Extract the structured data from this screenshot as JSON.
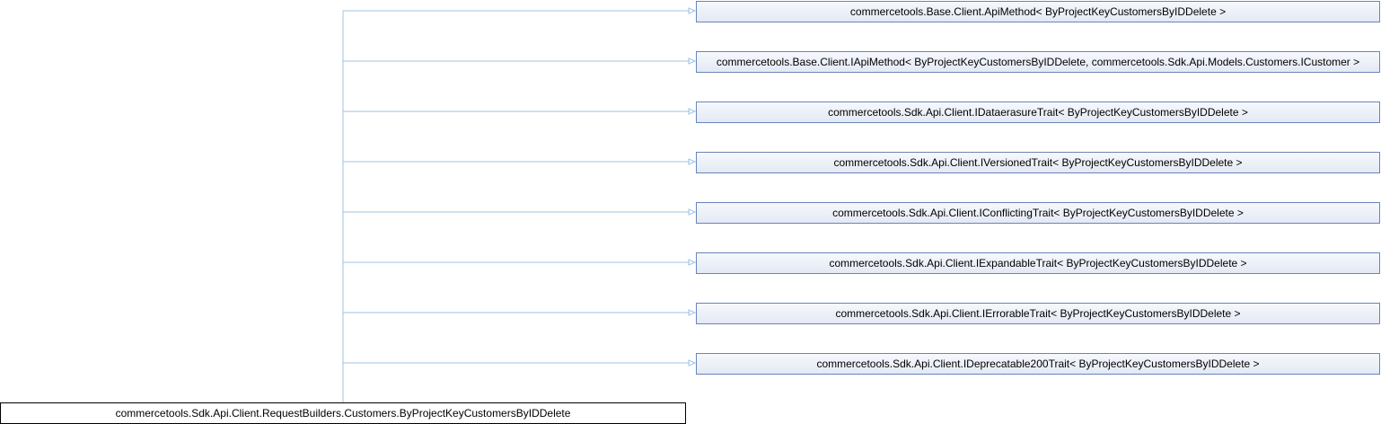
{
  "diagram": {
    "derived_class": "commercetools.Sdk.Api.Client.RequestBuilders.Customers.ByProjectKeyCustomersByIDDelete",
    "base_classes": [
      "commercetools.Base.Client.ApiMethod< ByProjectKeyCustomersByIDDelete >",
      "commercetools.Base.Client.IApiMethod< ByProjectKeyCustomersByIDDelete, commercetools.Sdk.Api.Models.Customers.ICustomer >",
      "commercetools.Sdk.Api.Client.IDataerasureTrait< ByProjectKeyCustomersByIDDelete >",
      "commercetools.Sdk.Api.Client.IVersionedTrait< ByProjectKeyCustomersByIDDelete >",
      "commercetools.Sdk.Api.Client.IConflictingTrait< ByProjectKeyCustomersByIDDelete >",
      "commercetools.Sdk.Api.Client.IExpandableTrait< ByProjectKeyCustomersByIDDelete >",
      "commercetools.Sdk.Api.Client.IErrorableTrait< ByProjectKeyCustomersByIDDelete >",
      "commercetools.Sdk.Api.Client.IDeprecatable200Trait< ByProjectKeyCustomersByIDDelete >"
    ],
    "colors": {
      "edge": "#9fc3e6",
      "node_border": "#6a85b8",
      "derived_border": "#000000"
    }
  }
}
